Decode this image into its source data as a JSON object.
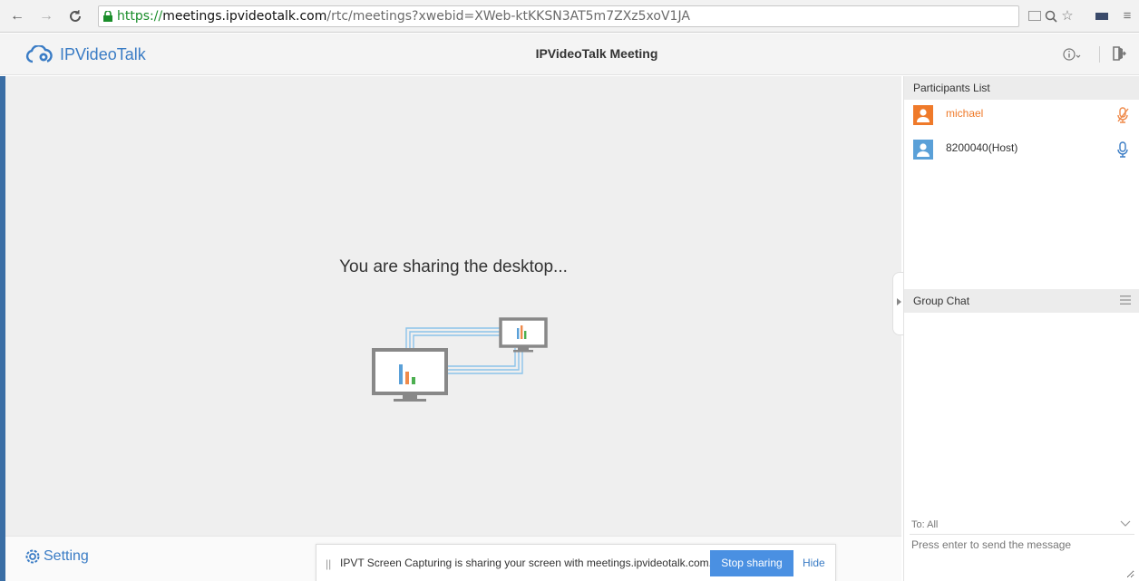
{
  "browser": {
    "url": {
      "scheme": "https://",
      "host": "meetings.ipvideotalk.com",
      "path": "/rtc/meetings?xwebid=XWeb-ktKKSN3AT5m7ZXz5xoV1JA"
    },
    "icons": [
      "back-arrow-icon",
      "forward-arrow-icon",
      "reload-icon",
      "lock-icon",
      "cast-icon",
      "zoom-icon",
      "star-icon",
      "extension-icon",
      "menu-icon"
    ]
  },
  "app": {
    "logo_text": "IPVideoTalk",
    "title": "IPVideoTalk Meeting",
    "brand_color": "#3a7cc5"
  },
  "stage": {
    "message": "You are sharing the desktop...",
    "graphic": "screen-share-illustration"
  },
  "bottombar": {
    "setting_label": "Setting",
    "notification": {
      "text": "IPVT Screen Capturing is sharing your screen with meetings.ipvideotalk.com.",
      "stop_label": "Stop sharing",
      "hide_label": "Hide"
    }
  },
  "participants": {
    "header": "Participants List",
    "items": [
      {
        "name": "michael",
        "color": "#ef7a2a",
        "mic": "muted"
      },
      {
        "name": "8200040(Host)",
        "color": "#5aa0d8",
        "mic": "active"
      }
    ]
  },
  "chat": {
    "header": "Group Chat",
    "to_label": "To: All",
    "input_placeholder": "Press enter to send the message"
  }
}
